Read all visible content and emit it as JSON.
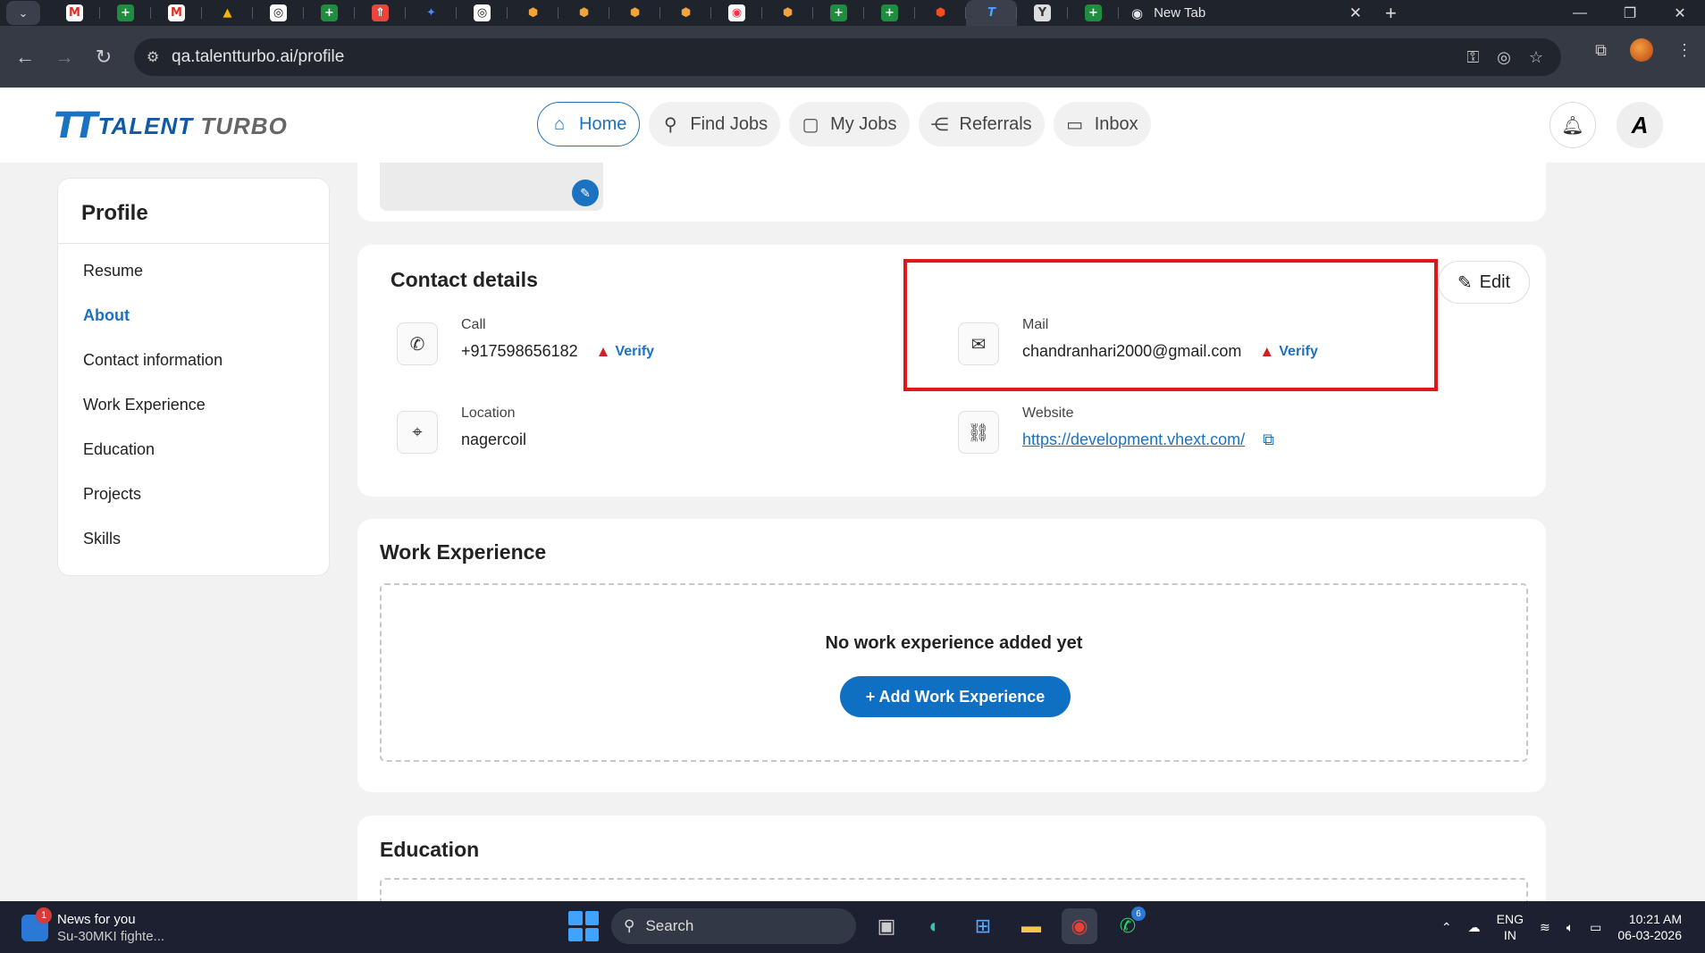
{
  "browser": {
    "tabs": [
      "M",
      "+",
      "M",
      "▲",
      "◎",
      "+",
      "⇑",
      "✦",
      "◎",
      "⬢",
      "⬢",
      "⬢",
      "⬢",
      "◉",
      "⬢",
      "+",
      "+",
      "⬢",
      "T",
      "Y",
      "+"
    ],
    "new_tab_label": "New Tab",
    "url": "qa.talentturbo.ai/profile"
  },
  "app": {
    "logo_mark": "TT",
    "logo_text_1": "TALENT",
    "logo_text_2": "TURBO",
    "nav": [
      {
        "label": "Home",
        "icon": "home-icon"
      },
      {
        "label": "Find Jobs",
        "icon": "search-icon"
      },
      {
        "label": "My Jobs",
        "icon": "briefcase-icon"
      },
      {
        "label": "Referrals",
        "icon": "share-icon"
      },
      {
        "label": "Inbox",
        "icon": "chat-icon"
      }
    ],
    "avatar_initials": "A"
  },
  "sidebar": {
    "title": "Profile",
    "items": [
      "Resume",
      "About",
      "Contact information",
      "Work Experience",
      "Education",
      "Projects",
      "Skills"
    ],
    "active": "About"
  },
  "contact": {
    "title": "Contact details",
    "edit_label": "Edit",
    "call_label": "Call",
    "call_value": "+917598656182",
    "verify_label": "Verify",
    "mail_label": "Mail",
    "mail_value": "chandranhari2000@gmail.com",
    "location_label": "Location",
    "location_value": "nagercoil",
    "website_label": "Website",
    "website_value": "https://development.vhext.com/"
  },
  "work": {
    "title": "Work Experience",
    "empty_text": "No work experience added yet",
    "add_label": "+ Add Work Experience"
  },
  "education": {
    "title": "Education"
  },
  "taskbar": {
    "news_badge": "1",
    "news_title": "News for you",
    "news_sub": "Su-30MKI fighte...",
    "search_label": "Search",
    "whatsapp_badge": "6",
    "lang_1": "ENG",
    "lang_2": "IN",
    "time": "10:21 AM",
    "date": "06-03-2026"
  },
  "colors": {
    "accent": "#1b72c0",
    "highlight": "#e0181e",
    "warning": "#d32020"
  }
}
